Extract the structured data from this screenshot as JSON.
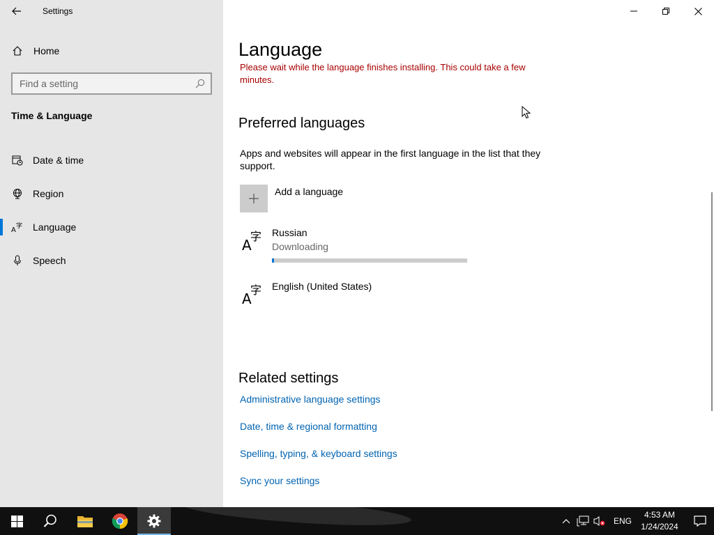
{
  "window": {
    "app_title": "Settings"
  },
  "sidebar": {
    "home_label": "Home",
    "search": {
      "placeholder": "Find a setting"
    },
    "section_title": "Time & Language",
    "items": [
      {
        "label": "Date & time",
        "icon": "date-time-icon",
        "selected": false
      },
      {
        "label": "Region",
        "icon": "globe-icon",
        "selected": false
      },
      {
        "label": "Language",
        "icon": "language-icon",
        "selected": true
      },
      {
        "label": "Speech",
        "icon": "microphone-icon",
        "selected": false
      }
    ]
  },
  "main": {
    "title": "Language",
    "warning": "Please wait while the language finishes installing. This could take a few minutes.",
    "preferred": {
      "heading": "Preferred languages",
      "description": "Apps and websites will appear in the first language in the list that they support.",
      "add_label": "Add a language",
      "languages": [
        {
          "name": "Russian",
          "status": "Downloading",
          "progress_percent": 1
        },
        {
          "name": "English (United States)",
          "status": ""
        }
      ]
    },
    "related": {
      "heading": "Related settings",
      "links": [
        "Administrative language settings",
        "Date, time & regional formatting",
        "Spelling, typing, & keyboard settings",
        "Sync your settings"
      ]
    }
  },
  "taskbar": {
    "tray": {
      "input_language": "ENG",
      "time": "4:53 AM",
      "date": "1/24/2024"
    }
  },
  "colors": {
    "accent": "#0078d7",
    "link": "#0063b1",
    "warning": "#a80000",
    "sidebar_bg": "#e6e6e6",
    "taskbar_bg": "#101010"
  }
}
